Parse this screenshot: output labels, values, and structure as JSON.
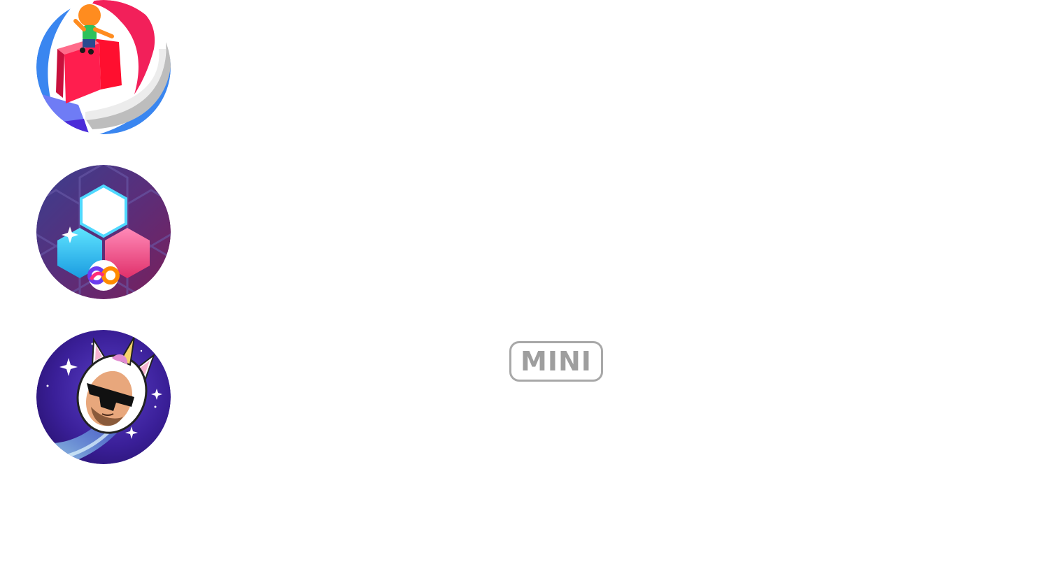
{
  "games": [
    {
      "icon": "stack-rider-game-icon"
    },
    {
      "icon": "hexagon-puzzle-game-icon"
    },
    {
      "icon": "unicorn-space-rider-game-icon"
    }
  ],
  "badge": {
    "label": "MINI"
  }
}
